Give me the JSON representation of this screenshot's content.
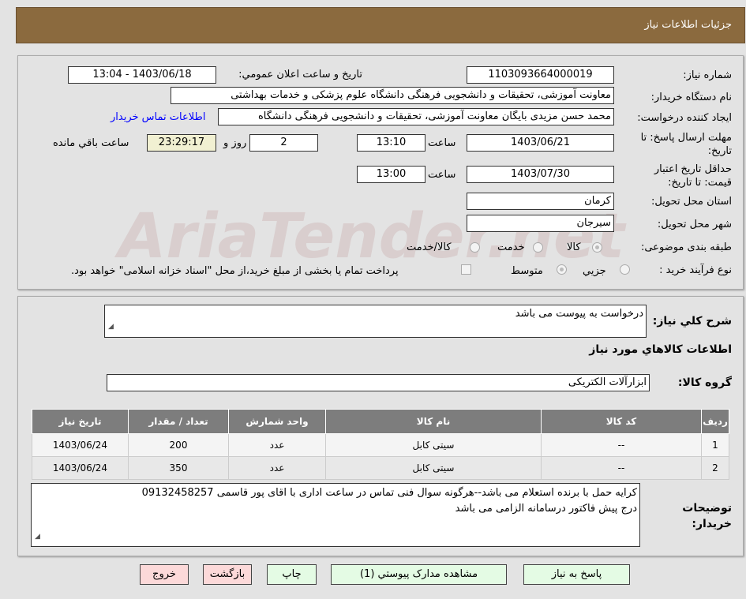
{
  "header": {
    "title": "جزئیات اطلاعات نیاز"
  },
  "watermark": "AriaTender.net",
  "form": {
    "need_number_label": "شماره نیاز:",
    "need_number": "1103093664000019",
    "announce_label": "تاریخ و ساعت اعلان عمومي:",
    "announce_value": "1403/06/18 - 13:04",
    "buyer_org_label": "نام دستگاه خریدار:",
    "buyer_org": "معاونت آموزشی، تحقیقات و دانشجویی فرهنگی دانشگاه علوم پزشکی و خدمات بهداشتی",
    "creator_label": "ایجاد کننده درخواست:",
    "creator": "محمد حسن  مزیدی بایگان معاونت آموزشی، تحقیقات و دانشجویی فرهنگی دانشگاه",
    "contact_link": "اطلاعات تماس خریدار",
    "deadline_label": "مهلت ارسال پاسخ: تا تاریخ:",
    "deadline_date": "1403/06/21",
    "time_label": "ساعت",
    "deadline_time": "13:10",
    "days": "2",
    "days_label": "روز و",
    "remaining": "23:29:17",
    "remaining_label": "ساعت باقي مانده",
    "validity_label": "حداقل تاریخ اعتبار قیمت: تا تاریخ:",
    "validity_date": "1403/07/30",
    "validity_time": "13:00",
    "province_label": "استان محل تحویل:",
    "province": "کرمان",
    "city_label": "شهر محل تحویل:",
    "city": "سیرجان",
    "category_label": "طبقه بندی موضوعی:",
    "category_options": [
      "کالا",
      "خدمت",
      "کالا/خدمت"
    ],
    "category_selected": "کالا",
    "process_label": "نوع فرآیند خرید :",
    "process_options": [
      "جزیي",
      "متوسط"
    ],
    "process_selected": "متوسط",
    "treasury_note": "پرداخت تمام یا بخشی از مبلغ خرید،از محل \"اسناد خزانه اسلامی\" خواهد بود."
  },
  "details": {
    "summary_label": "شرح کلي نیاز:",
    "summary": "درخواست به پیوست می باشد",
    "goods_info_title": "اطلاعات کالاهاي مورد نیاز",
    "group_label": "گروه کالا:",
    "group": "ابزارآلات الکتریکی",
    "table": {
      "headers": [
        "ردیف",
        "کد کالا",
        "نام کالا",
        "واحد شمارش",
        "تعداد / مقدار",
        "تاریخ نیاز"
      ],
      "rows": [
        [
          "1",
          "--",
          "سیتی کابل",
          "عدد",
          "200",
          "1403/06/24"
        ],
        [
          "2",
          "--",
          "سیتی کابل",
          "عدد",
          "350",
          "1403/06/24"
        ]
      ]
    },
    "buyer_notes_label": "توضیحات خریدار:",
    "buyer_notes_line1": "کرایه حمل با برنده استعلام می باشد--هرگونه سوال فنی تماس در ساعت اداری با اقای پور قاسمی 09132458257",
    "buyer_notes_line2": "درج پیش فاکتور درسامانه الزامی می باشد"
  },
  "buttons": {
    "reply": "پاسخ به نیاز",
    "attachments": "مشاهده مدارک پیوستي (1)",
    "print": "چاپ",
    "back": "بازگشت",
    "exit": "خروج"
  },
  "colors": {
    "header": "#8b6a3e",
    "link": "#0000ff",
    "green_button": "#e4fbe4",
    "red_button": "#fcd9d9"
  }
}
